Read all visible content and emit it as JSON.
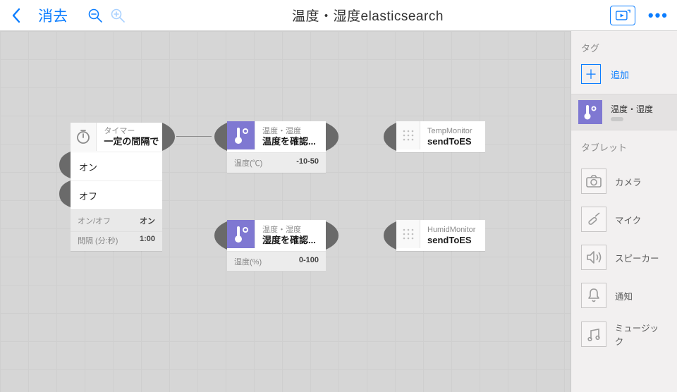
{
  "header": {
    "clear_label": "消去",
    "title": "温度・湿度elasticsearch",
    "more_label": "•••"
  },
  "timer": {
    "category": "タイマー",
    "label": "一定の間隔で",
    "on": "オン",
    "off": "オフ",
    "onoff_label": "オン/オフ",
    "onoff_value": "オン",
    "interval_label": "間隔 (分:秒)",
    "interval_value": "1:00"
  },
  "temp": {
    "category": "温度・湿度",
    "label": "温度を確認...",
    "meta_label": "温度(℃)",
    "meta_value": "-10-50"
  },
  "humid": {
    "category": "温度・湿度",
    "label": "湿度を確認...",
    "meta_label": "湿度(%)",
    "meta_value": "0-100"
  },
  "script1": {
    "category": "TempMonitor",
    "label": "sendToES"
  },
  "script2": {
    "category": "HumidMonitor",
    "label": "sendToES"
  },
  "sidebar": {
    "tags_title": "タグ",
    "add_label": "追加",
    "tag_name": "温度・湿度",
    "tablet_title": "タブレット",
    "items": [
      {
        "label": "カメラ"
      },
      {
        "label": "マイク"
      },
      {
        "label": "スピーカー"
      },
      {
        "label": "通知"
      },
      {
        "label": "ミュージック"
      }
    ]
  },
  "colors": {
    "accent": "#0b7dff",
    "purple": "#7f78d2"
  }
}
